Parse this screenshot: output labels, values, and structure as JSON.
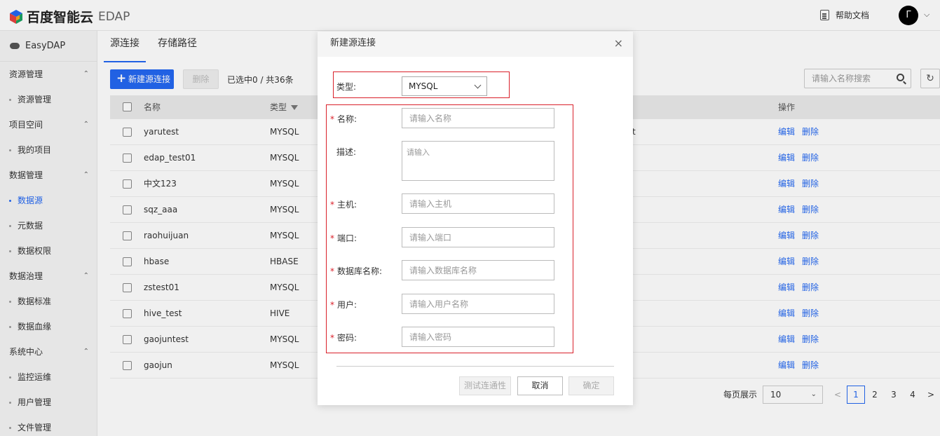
{
  "header": {
    "brand": "百度智能云",
    "product": "EDAP",
    "help": "帮助文档",
    "avatar_letter": "Γ",
    "brand_colors": [
      "#2468f2",
      "#e8423f",
      "#1ba261",
      "#f5a623"
    ]
  },
  "sidebar": {
    "workspace": "EasyDAP",
    "groups": [
      {
        "label": "资源管理",
        "items": [
          "资源管理"
        ]
      },
      {
        "label": "项目空间",
        "items": [
          "我的项目"
        ]
      },
      {
        "label": "数据管理",
        "items": [
          "数据源",
          "元数据",
          "数据权限"
        ]
      },
      {
        "label": "数据治理",
        "items": [
          "数据标准",
          "数据血缘"
        ]
      },
      {
        "label": "系统中心",
        "items": [
          "监控运维",
          "用户管理",
          "文件管理"
        ]
      }
    ],
    "active_item": "数据源"
  },
  "main": {
    "tabs": [
      "源连接",
      "存储路径"
    ],
    "new_button": "新建源连接",
    "delete_button": "删除",
    "selection_count": "已选中0 / 共36条",
    "search_placeholder": "请输入名称搜索",
    "columns": {
      "name": "名称",
      "type": "类型",
      "ops": "操作"
    },
    "rows": [
      {
        "name": "yarutest",
        "type": "MYSQL"
      },
      {
        "name": "edap_test01",
        "type": "MYSQL"
      },
      {
        "name": "中文123",
        "type": "MYSQL"
      },
      {
        "name": "sqz_aaa",
        "type": "MYSQL"
      },
      {
        "name": "raohuijuan",
        "type": "MYSQL"
      },
      {
        "name": "hbase",
        "type": "HBASE"
      },
      {
        "name": "zstest01",
        "type": "MYSQL"
      },
      {
        "name": "hive_test",
        "type": "HIVE"
      },
      {
        "name": "gaojuntest",
        "type": "MYSQL"
      },
      {
        "name": "gaojun",
        "type": "MYSQL"
      }
    ],
    "row_fragment": "t",
    "op_edit": "编辑",
    "op_delete": "删除",
    "pager": {
      "label": "每页展示",
      "page_size": "10",
      "pages": [
        "1",
        "2",
        "3",
        "4"
      ],
      "current": "1",
      "prev": "<",
      "next": ">"
    }
  },
  "dialog": {
    "title": "新建源连接",
    "close": "×",
    "type_label": "类型:",
    "type_value": "MYSQL",
    "fields": [
      {
        "label": "名称:",
        "required": true,
        "placeholder": "请输入名称"
      },
      {
        "label": "描述:",
        "required": false,
        "placeholder": "请输入"
      },
      {
        "label": "主机:",
        "required": true,
        "placeholder": "请输入主机"
      },
      {
        "label": "端口:",
        "required": true,
        "placeholder": "请输入端口"
      },
      {
        "label": "数据库名称:",
        "required": true,
        "placeholder": "请输入数据库名称"
      },
      {
        "label": "用户:",
        "required": true,
        "placeholder": "请输入用户名称"
      },
      {
        "label": "密码:",
        "required": true,
        "placeholder": "请输入密码"
      }
    ],
    "required_mark": "*",
    "test_button": "测试连通性",
    "cancel_button": "取消",
    "confirm_button": "确定",
    "highlight_color": "#d9202a"
  }
}
